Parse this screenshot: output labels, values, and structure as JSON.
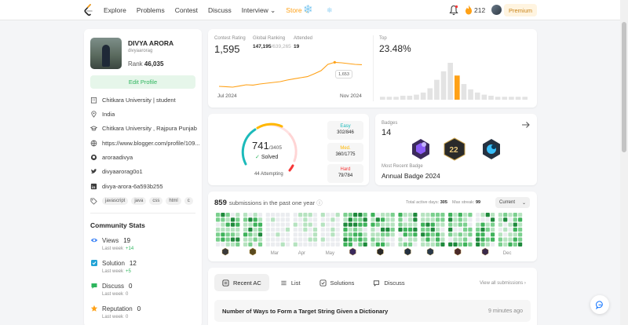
{
  "nav": {
    "links": [
      "Explore",
      "Problems",
      "Contest",
      "Discuss",
      "Interview ⌄",
      "Store ⌄"
    ],
    "streak": "212",
    "premium": "Premium"
  },
  "profile": {
    "name": "DIVYA ARORA",
    "handle": "divyaarorag",
    "rank_label": "Rank",
    "rank": "46,035",
    "edit_label": "Edit Profile",
    "info": [
      "Chitkara University | student",
      "India",
      "Chitkara University , Rajpura Punjab",
      "https://www.blogger.com/profile/109...",
      "aroraadivya",
      "divyaarorag0o1",
      "divya-arora-6a593b255"
    ],
    "tags": [
      "javascript",
      "java",
      "css",
      "html",
      "c"
    ]
  },
  "community": {
    "title": "Community Stats",
    "stats": [
      {
        "label": "Views",
        "value": "19",
        "sub": "Last week",
        "delta": "+14",
        "color": "#3b82f6"
      },
      {
        "label": "Solution",
        "value": "12",
        "sub": "Last week",
        "delta": "+5",
        "color": "#22a3d6"
      },
      {
        "label": "Discuss",
        "value": "0",
        "sub": "Last week",
        "delta": "0",
        "color": "#2db55d"
      },
      {
        "label": "Reputation",
        "value": "0",
        "sub": "Last week",
        "delta": "0",
        "color": "#ffa116"
      }
    ]
  },
  "contest": {
    "rating_label": "Contest Rating",
    "rating": "1,595",
    "global_label": "Global Ranking",
    "global_rank": "147,195",
    "global_total": "/639,265",
    "attended_label": "Attended",
    "attended": "19",
    "tooltip": "1,653",
    "x_start": "Jul 2024",
    "x_end": "Nov 2024",
    "top_label": "Top",
    "top_pct": "23.48%"
  },
  "chart_data": {
    "type": "line",
    "x": [
      "Jul 2024",
      "Nov 2024"
    ],
    "series": [
      {
        "values": [
          1500,
          1498,
          1495,
          1502,
          1510,
          1508,
          1515,
          1520,
          1525,
          1530,
          1540,
          1548,
          1555,
          1562,
          1580,
          1600,
          1640,
          1653,
          1650,
          1645,
          1640,
          1638
        ]
      }
    ],
    "histogram": [
      2,
      2,
      2,
      3,
      3,
      4,
      6,
      10,
      18,
      26,
      34,
      22,
      14,
      9,
      6,
      4,
      3,
      2,
      2,
      2,
      2,
      2
    ],
    "highlight_index": 11,
    "colors": {
      "line": "#ffa116",
      "bar": "#e3e3e3",
      "highlight": "#ffa116"
    }
  },
  "solved": {
    "count": "741",
    "total": "/3405",
    "solved_label": "Solved",
    "attempting": "44 Attempting",
    "easy": {
      "label": "Easy",
      "value": "302/846",
      "color": "#1cbaba"
    },
    "medium": {
      "label": "Med.",
      "value": "360/1775",
      "color": "#ffb700"
    },
    "hard": {
      "label": "Hard",
      "value": "79/784",
      "color": "#f63737"
    }
  },
  "badges": {
    "label": "Badges",
    "count": "14",
    "recent_label": "Most Recent Badge",
    "recent_name": "Annual Badge 2024"
  },
  "submissions": {
    "count": "859",
    "text": "submissions in the past one year",
    "active_label": "Total active days:",
    "active": "305",
    "streak_label": "Max streak:",
    "streak": "99",
    "current": "Current",
    "months": [
      "",
      "",
      "Mar",
      "Apr",
      "May",
      "",
      "",
      "",
      "",
      "",
      "",
      "Dec"
    ]
  },
  "recent": {
    "tabs": [
      "Recent AC",
      "List",
      "Solutions",
      "Discuss"
    ],
    "view_all": "View all submissions",
    "row_title": "Number of Ways to Form a Target String Given a Dictionary",
    "row_time": "9 minutes ago"
  }
}
